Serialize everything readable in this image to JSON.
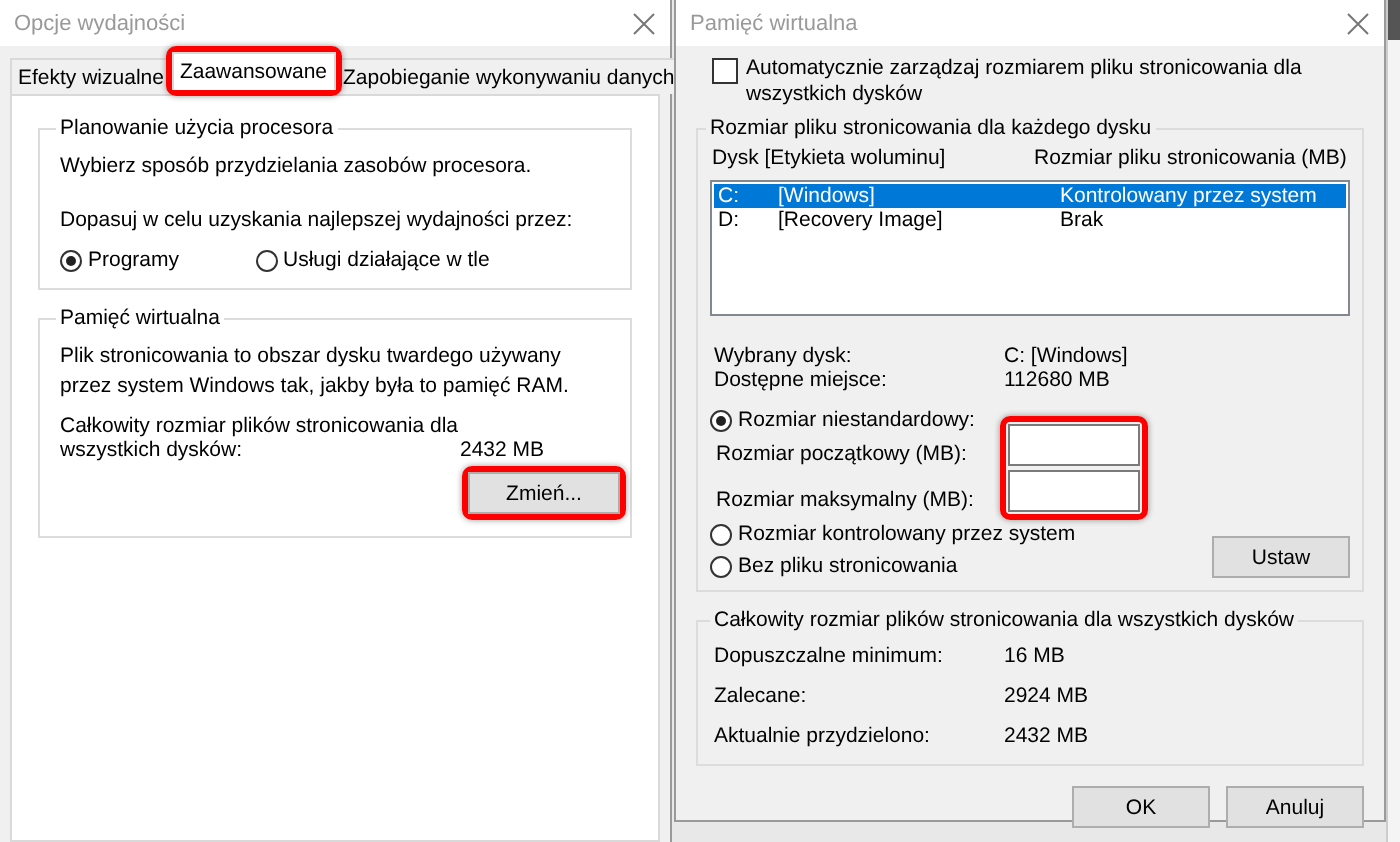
{
  "left_window": {
    "title": "Opcje wydajności",
    "tabs": [
      {
        "label": "Efekty wizualne",
        "selected": false,
        "highlighted": false
      },
      {
        "label": "Zaawansowane",
        "selected": true,
        "highlighted": true
      },
      {
        "label": "Zapobieganie wykonywaniu danych",
        "selected": false,
        "highlighted": false
      }
    ],
    "processor_group": {
      "title": "Planowanie użycia procesora",
      "description": "Wybierz sposób przydzielania zasobów procesora.",
      "prompt": "Dopasuj w celu uzyskania najlepszej wydajności przez:",
      "options": [
        {
          "label": "Programy",
          "selected": true
        },
        {
          "label": "Usługi działające w tle",
          "selected": false
        }
      ]
    },
    "memory_group": {
      "title": "Pamięć wirtualna",
      "description": "Plik stronicowania to obszar dysku twardego używany przez system Windows tak, jakby była to pamięć RAM.",
      "total_label": "Całkowity rozmiar plików stronicowania dla wszystkich dysków:",
      "total_value": "2432  MB",
      "button": {
        "label": "Zmień...",
        "highlighted": true
      }
    }
  },
  "right_window": {
    "title": "Pamięć wirtualna",
    "auto_checkbox": {
      "label": "Automatycznie zarządzaj rozmiarem pliku stronicowania dla wszystkich dysków",
      "checked": false
    },
    "per_disk_group": {
      "title": "Rozmiar pliku stronicowania dla każdego dysku",
      "columns": [
        "Dysk [Etykieta woluminu]",
        "Rozmiar pliku stronicowania (MB)"
      ],
      "rows": [
        {
          "drive": "C:",
          "label": "[Windows]",
          "size": "Kontrolowany przez system",
          "selected": true
        },
        {
          "drive": "D:",
          "label": "[Recovery Image]",
          "size": "Brak",
          "selected": false
        }
      ],
      "selected_drive_label": "Wybrany dysk:",
      "selected_drive_value": "C:  [Windows]",
      "free_space_label": "Dostępne miejsce:",
      "free_space_value": "112680  MB",
      "size_options": [
        {
          "label": "Rozmiar niestandardowy:",
          "selected": true
        },
        {
          "label": "Rozmiar kontrolowany przez system",
          "selected": false
        },
        {
          "label": "Bez pliku stronicowania",
          "selected": false
        }
      ],
      "initial_label": "Rozmiar początkowy (MB):",
      "max_label": "Rozmiar maksymalny (MB):",
      "fields_highlighted": true,
      "set_button": "Ustaw"
    },
    "totals_group": {
      "title": "Całkowity rozmiar plików stronicowania dla wszystkich dysków",
      "rows": [
        {
          "label": "Dopuszczalne minimum:",
          "value": "16  MB"
        },
        {
          "label": "Zalecane:",
          "value": "2924  MB"
        },
        {
          "label": "Aktualnie przydzielono:",
          "value": "2432  MB"
        }
      ]
    },
    "buttons": [
      "OK",
      "Anuluj"
    ]
  }
}
